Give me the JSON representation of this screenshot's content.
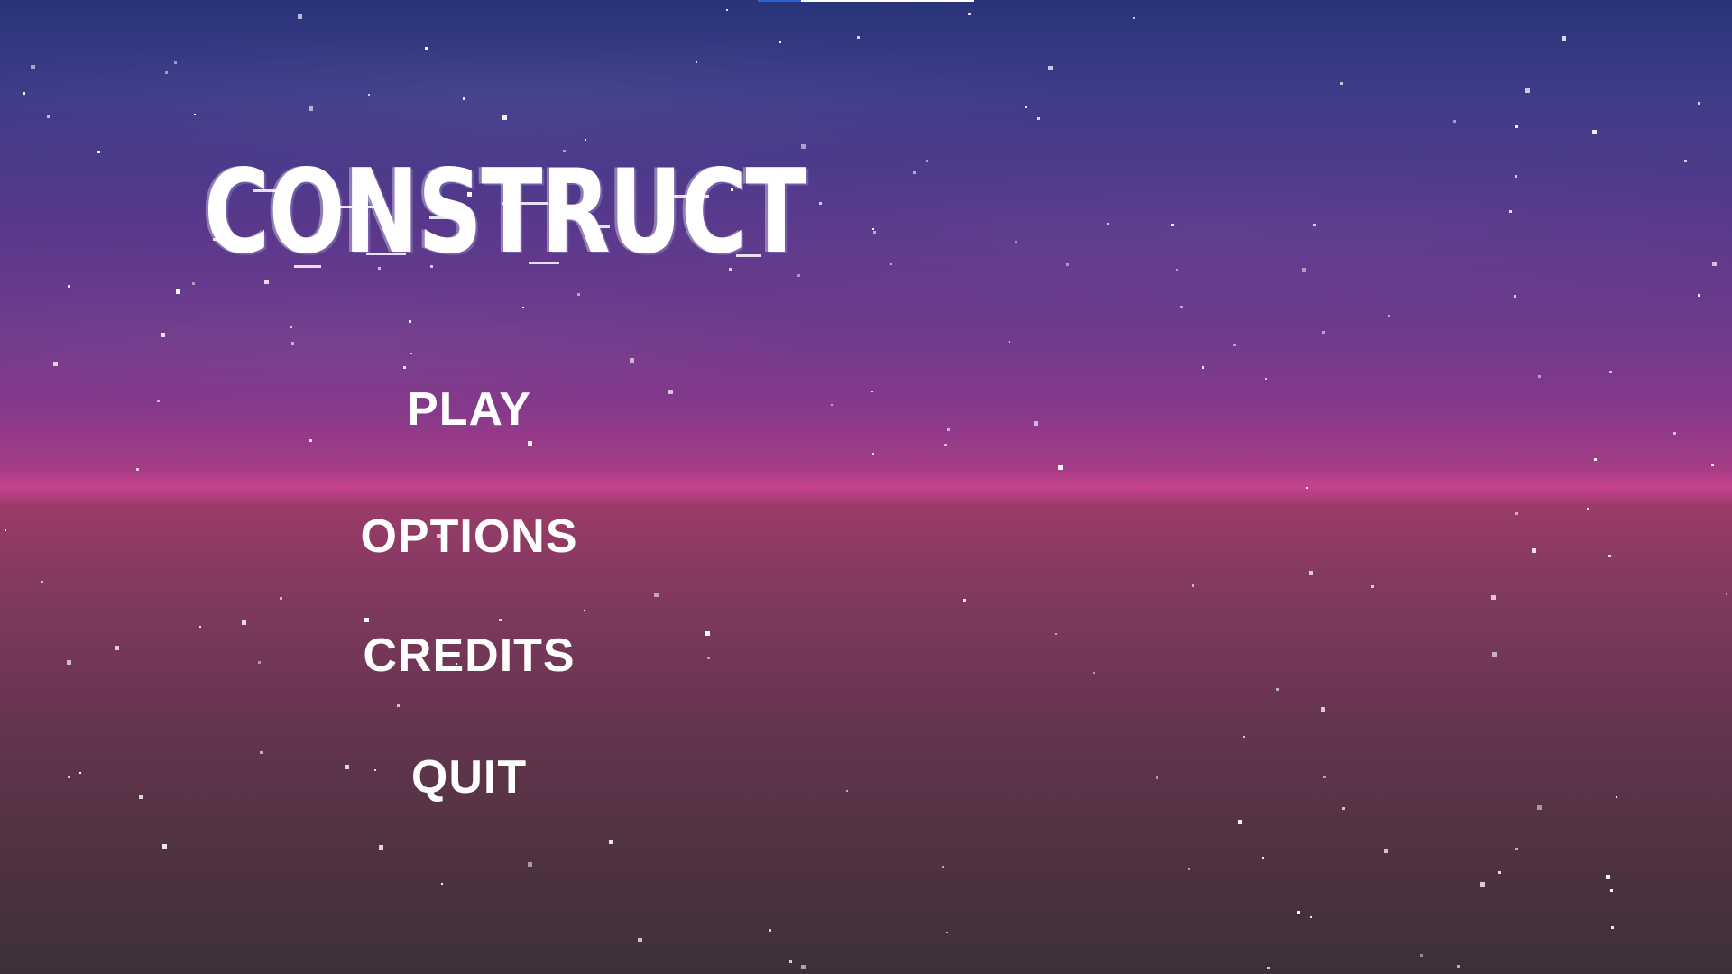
{
  "game": {
    "title": "CONSTRUCT"
  },
  "menu": {
    "items": [
      {
        "label": "PLAY"
      },
      {
        "label": "OPTIONS"
      },
      {
        "label": "CREDITS"
      },
      {
        "label": "QUIT"
      }
    ]
  },
  "colors": {
    "sky_top": "#283479",
    "horizon": "#b23f83",
    "ground_bottom": "#3d3038",
    "text": "#ffffff",
    "accent_blue": "#2b63d6"
  }
}
